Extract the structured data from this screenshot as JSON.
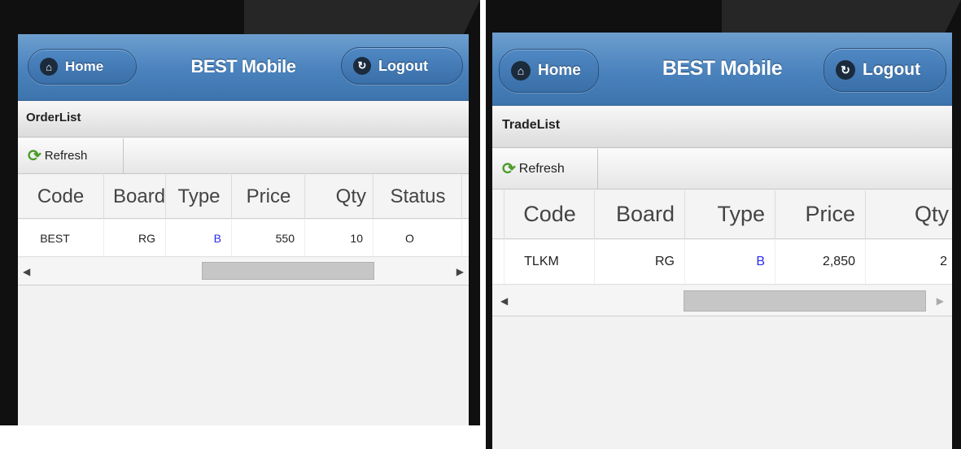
{
  "left": {
    "header": {
      "title": "BEST Mobile",
      "home_label": "Home",
      "logout_label": "Logout"
    },
    "list_title": "OrderList",
    "toolbar": {
      "refresh_label": "Refresh"
    },
    "columns": [
      "Code",
      "Board",
      "Type",
      "Price",
      "Qty",
      "Status"
    ],
    "rows": [
      {
        "code": "BEST",
        "board": "RG",
        "type": "B",
        "price": "550",
        "qty": "10",
        "status": "O"
      }
    ]
  },
  "right": {
    "header": {
      "title": "BEST Mobile",
      "home_label": "Home",
      "logout_label": "Logout"
    },
    "list_title": "TradeList",
    "toolbar": {
      "refresh_label": "Refresh"
    },
    "columns": [
      "Code",
      "Board",
      "Type",
      "Price",
      "Qty"
    ],
    "rows": [
      {
        "code": "TLKM",
        "board": "RG",
        "type": "B",
        "price": "2,850",
        "qty": "2"
      }
    ]
  },
  "colors": {
    "header_blue": "#4a82bd",
    "type_buy": "#2a2af0",
    "refresh_green": "#4c9d2a"
  },
  "icons": {
    "home": "home-icon",
    "logout": "logout-icon",
    "refresh": "refresh-icon"
  }
}
